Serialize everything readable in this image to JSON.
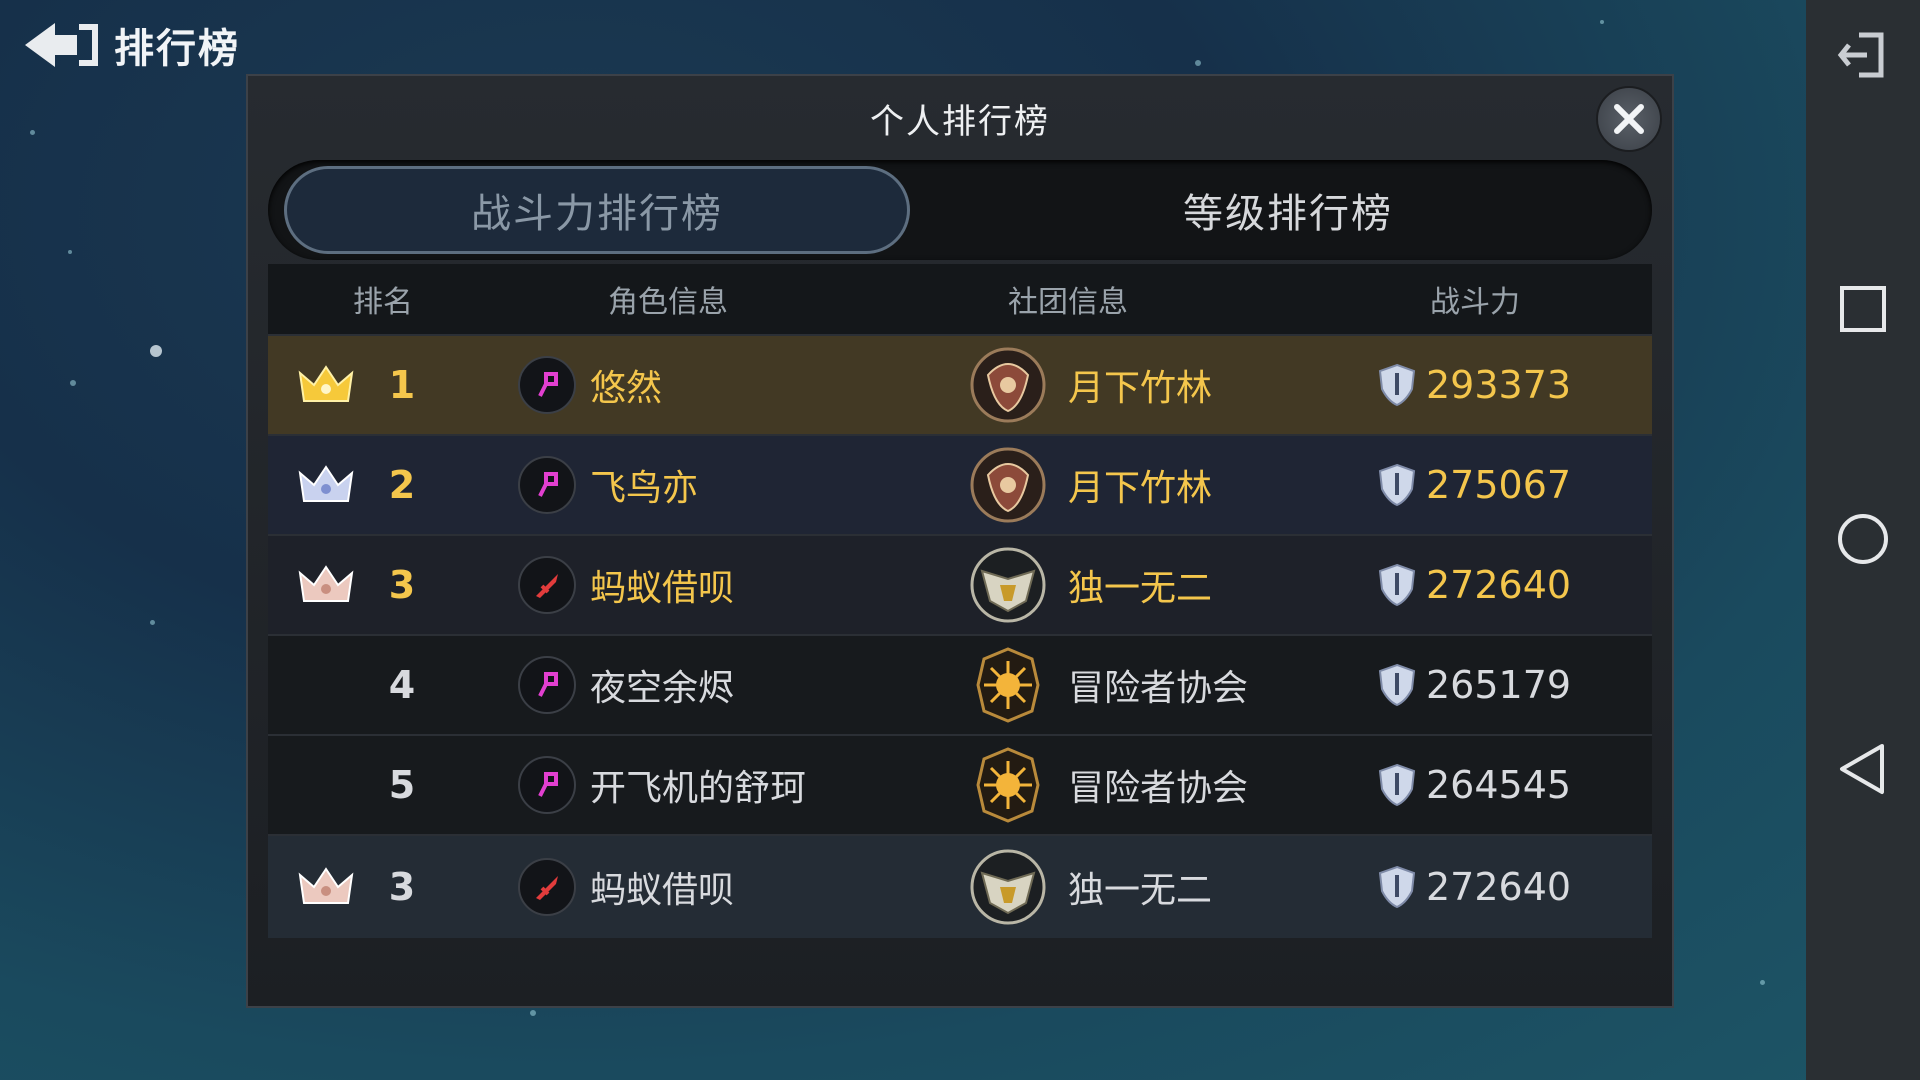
{
  "topbar": {
    "title": "排行榜"
  },
  "dialog": {
    "title": "个人排行榜",
    "tabs": [
      {
        "label": "战斗力排行榜",
        "active": true
      },
      {
        "label": "等级排行榜",
        "active": false
      }
    ],
    "table": {
      "headers": [
        "排名",
        "角色信息",
        "社团信息",
        "战斗力"
      ],
      "rows": [
        {
          "rank": "1",
          "crown": "gold-crown-icon",
          "job_icon": "magenta-wand-icon",
          "name": "悠然",
          "guild_emblem": "dragon-emblem-icon",
          "guild": "月下竹林",
          "power": "293373"
        },
        {
          "rank": "2",
          "crown": "silver-crown-icon",
          "job_icon": "magenta-wand-icon",
          "name": "飞鸟亦",
          "guild_emblem": "dragon-emblem-icon",
          "guild": "月下竹林",
          "power": "275067"
        },
        {
          "rank": "3",
          "crown": "bronze-crown-icon",
          "job_icon": "red-sword-icon",
          "name": "蚂蚁借呗",
          "guild_emblem": "eagle-emblem-icon",
          "guild": "独一无二",
          "power": "272640"
        },
        {
          "rank": "4",
          "crown": "",
          "job_icon": "magenta-wand-icon",
          "name": "夜空余烬",
          "guild_emblem": "sun-emblem-icon",
          "guild": "冒险者协会",
          "power": "265179"
        },
        {
          "rank": "5",
          "crown": "",
          "job_icon": "magenta-wand-icon",
          "name": "开飞机的舒珂",
          "guild_emblem": "sun-emblem-icon",
          "guild": "冒险者协会",
          "power": "264545"
        }
      ],
      "self_row": {
        "rank": "3",
        "crown": "bronze-crown-icon",
        "job_icon": "red-sword-icon",
        "name": "蚂蚁借呗",
        "guild_emblem": "eagle-emblem-icon",
        "guild": "独一无二",
        "power": "272640"
      }
    }
  },
  "colors": {
    "gold_text": "#f4c64c",
    "white_text": "#d8dade",
    "gold_row_bg": "#423924",
    "magenta_icon": "#e23fd0",
    "red_icon": "#e23c3c"
  },
  "navbar": {
    "buttons": [
      "exit-icon",
      "recents-square-icon",
      "home-circle-icon",
      "back-triangle-icon"
    ]
  }
}
